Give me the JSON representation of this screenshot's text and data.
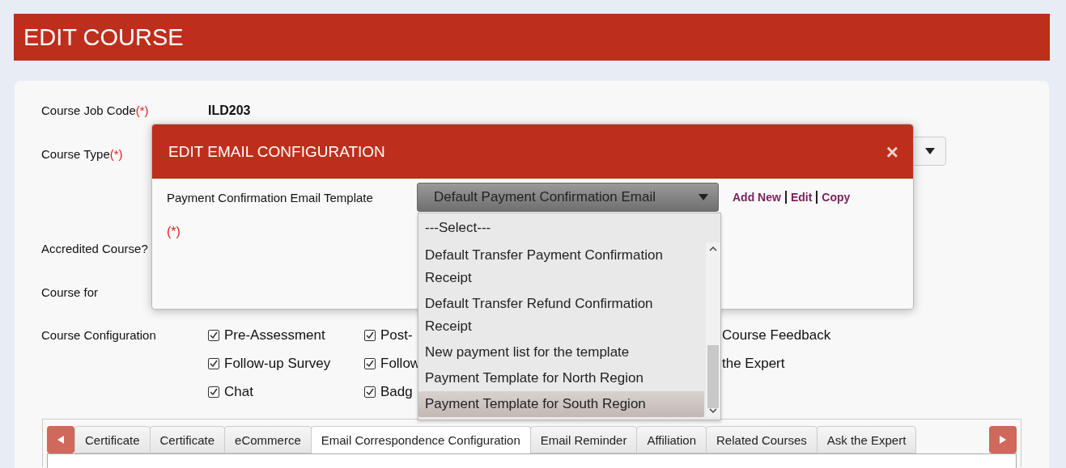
{
  "page": {
    "title": "EDIT COURSE"
  },
  "form": {
    "job_code": {
      "label": "Course Job Code",
      "required": "(*)",
      "value": "ILD203"
    },
    "course_type": {
      "label": "Course Type",
      "required": "(*)"
    },
    "accredited": {
      "label": "Accredited Course?"
    },
    "course_for": {
      "label": "Course for"
    },
    "configuration": {
      "label": "Course Configuration",
      "columns": [
        [
          {
            "kind": "checkbox",
            "label": "Pre-Assessment",
            "checked": true
          },
          {
            "kind": "checkbox",
            "label": "Follow-up Survey",
            "checked": true
          },
          {
            "kind": "checkbox",
            "label": "Chat",
            "checked": true
          }
        ],
        [
          {
            "kind": "checkbox",
            "label": "Post-",
            "checked": true
          },
          {
            "kind": "checkbox",
            "label": "Follow",
            "checked": true
          },
          {
            "kind": "checkbox",
            "label": "Badg",
            "checked": true
          }
        ],
        [
          {
            "kind": "text",
            "label": "Course Feedback"
          },
          {
            "kind": "text",
            "label": "the Expert"
          }
        ]
      ]
    }
  },
  "tabs": [
    {
      "label": "Certificate",
      "selected": false
    },
    {
      "label": "Certificate",
      "selected": false
    },
    {
      "label": "eCommerce",
      "selected": false
    },
    {
      "label": "Email Correspondence Configuration",
      "selected": true
    },
    {
      "label": "Email Reminder",
      "selected": false
    },
    {
      "label": "Affiliation",
      "selected": false
    },
    {
      "label": "Related Courses",
      "selected": false
    },
    {
      "label": "Ask the Expert",
      "selected": false
    }
  ],
  "dialog": {
    "title": "EDIT EMAIL CONFIGURATION",
    "close": "×",
    "field_label": "Payment Confirmation Email Template",
    "required": "(*)",
    "select": {
      "value": "Default Payment Confirmation Email",
      "pinned_option": "---Select---",
      "options": [
        {
          "label": "Default Transfer Payment Confirmation Receipt",
          "selected": false
        },
        {
          "label": "Default Transfer Refund Confirmation Receipt",
          "selected": false
        },
        {
          "label": "New payment list for the template",
          "selected": false
        },
        {
          "label": "Payment Template for North Region",
          "selected": false
        },
        {
          "label": "Payment Template for South Region",
          "selected": true
        }
      ]
    },
    "links": [
      "Add New",
      "Edit",
      "Copy"
    ]
  }
}
